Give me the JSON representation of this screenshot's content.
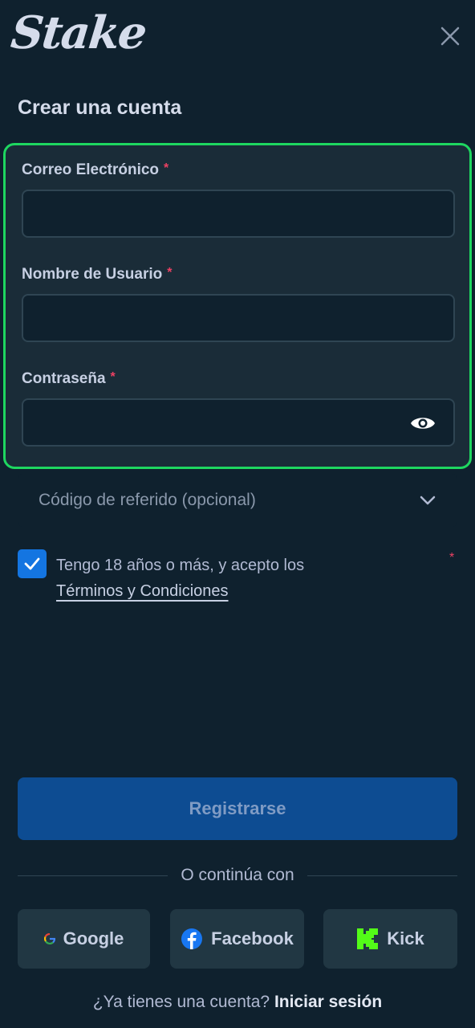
{
  "header": {
    "logo": "Stake",
    "title": "Crear una cuenta"
  },
  "form": {
    "email": {
      "label": "Correo Electrónico",
      "required_mark": "*",
      "value": ""
    },
    "username": {
      "label": "Nombre de Usuario",
      "required_mark": "*",
      "value": ""
    },
    "password": {
      "label": "Contraseña",
      "required_mark": "*",
      "value": ""
    },
    "referral": {
      "label": "Código de referido (opcional)"
    }
  },
  "terms": {
    "text": "Tengo 18 años o más, y acepto los",
    "link": "Términos y Condiciones",
    "required_mark": "*",
    "checked": true
  },
  "register_button": "Registrarse",
  "divider_text": "O continúa con",
  "social": {
    "google": "Google",
    "facebook": "Facebook",
    "kick": "Kick"
  },
  "footer": {
    "prompt": "¿Ya tienes una cuenta?",
    "login": "Iniciar sesión"
  },
  "colors": {
    "background": "#0f212e",
    "panel": "#1a2c38",
    "highlight_border": "#1ed760",
    "primary_button": "#0d4c92",
    "checkbox": "#1475e1",
    "required": "#ed4163",
    "kick_brand": "#53fc18",
    "facebook_brand": "#1877f2"
  }
}
